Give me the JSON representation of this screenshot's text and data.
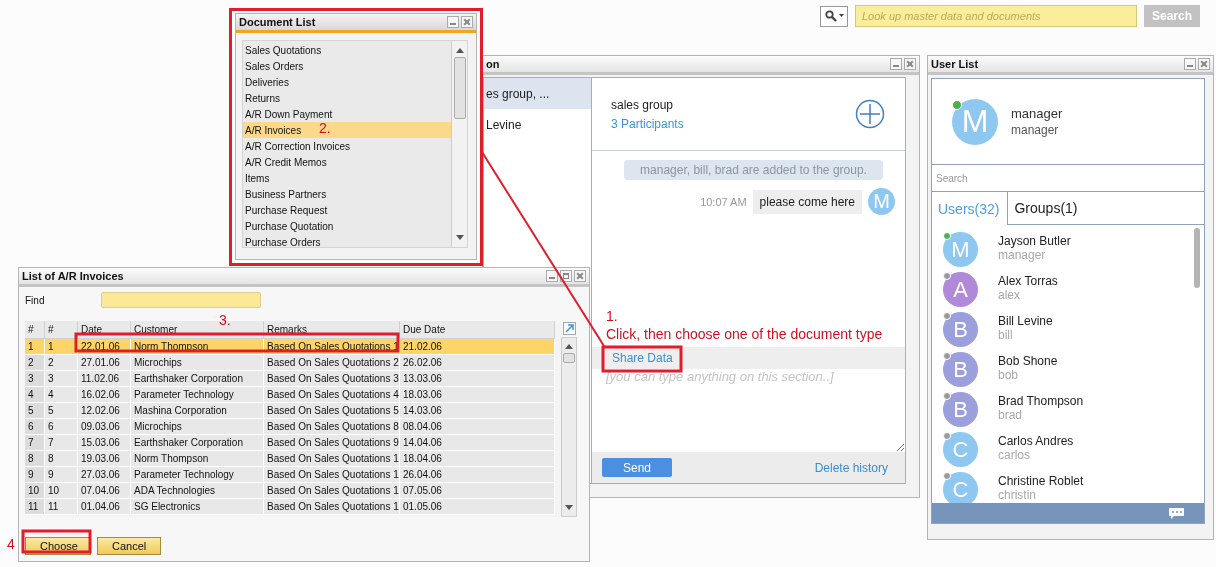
{
  "top_bar": {
    "search": {
      "placeholder": "Look up master data and documents"
    },
    "search_button": "Search"
  },
  "chat_window": {
    "title": "on",
    "active": false,
    "conversations": [
      {
        "label": "es group, ...",
        "selected": true
      },
      {
        "label": "Levine",
        "selected": false
      }
    ],
    "header": {
      "name": "sales group",
      "participants": "3 Participants"
    },
    "messages": [
      {
        "kind": "system",
        "text": "manager, bill, brad are added to the group."
      },
      {
        "kind": "outgoing",
        "time": "10:07 AM",
        "text": "please come here",
        "avatar": "M",
        "color": "#8ec8f0"
      }
    ],
    "share_link": "Share Data",
    "input": {
      "placeholder": "[you can type anything on this section..]"
    },
    "send_button": "Send",
    "delete_link": "Delete history"
  },
  "user_list": {
    "title": "User List",
    "active": false,
    "current_user": {
      "name": "manager",
      "username": "manager",
      "initial": "M",
      "color": "#8ec8f0",
      "online": true
    },
    "search": {
      "placeholder": "Search"
    },
    "tabs": [
      {
        "label": "Users(32)",
        "selected": true
      },
      {
        "label": "Groups(1)",
        "selected": false
      }
    ],
    "users": [
      {
        "name": "Jayson Butler",
        "username": "manager",
        "initial": "M",
        "color": "#8ec8f0",
        "online": true
      },
      {
        "name": "Alex Torras",
        "username": "alex",
        "initial": "A",
        "color": "#b08ad8",
        "online": false
      },
      {
        "name": "Bill Levine",
        "username": "bill",
        "initial": "B",
        "color": "#9b9fdc",
        "online": false
      },
      {
        "name": "Bob Shone",
        "username": "bob",
        "initial": "B",
        "color": "#9b9fdc",
        "online": false
      },
      {
        "name": "Brad Thompson",
        "username": "brad",
        "initial": "B",
        "color": "#9b9fdc",
        "online": false
      },
      {
        "name": "Carlos Andres",
        "username": "carlos",
        "initial": "C",
        "color": "#8ec8f0",
        "online": false
      },
      {
        "name": "Christine Roblet",
        "username": "christin",
        "initial": "C",
        "color": "#8ec8f0",
        "online": false
      }
    ]
  },
  "document_list": {
    "title": "Document List",
    "active": true,
    "items": [
      {
        "label": "Sales Quotations",
        "selected": false
      },
      {
        "label": "Sales Orders",
        "selected": false
      },
      {
        "label": "Deliveries",
        "selected": false
      },
      {
        "label": "Returns",
        "selected": false
      },
      {
        "label": "A/R Down Payment",
        "selected": false
      },
      {
        "label": "A/R Invoices",
        "selected": true
      },
      {
        "label": "A/R Correction Invoices",
        "selected": false
      },
      {
        "label": "A/R Credit Memos",
        "selected": false
      },
      {
        "label": "Items",
        "selected": false
      },
      {
        "label": "Business Partners",
        "selected": false
      },
      {
        "label": "Purchase Request",
        "selected": false
      },
      {
        "label": "Purchase Quotation",
        "selected": false
      },
      {
        "label": "Purchase Orders",
        "selected": false
      }
    ]
  },
  "invoice_list": {
    "title": "List of A/R Invoices",
    "active": false,
    "find_label": "Find",
    "columns": [
      "#",
      "#",
      "Date",
      "Customer",
      "Remarks",
      "Due Date"
    ],
    "rows": [
      {
        "cells": [
          "1",
          "1",
          "22.01.06",
          "Norm Thompson",
          "Based On Sales Quotations 1",
          "21.02.06"
        ],
        "selected": true
      },
      {
        "cells": [
          "2",
          "2",
          "27.01.06",
          "Microchips",
          "Based On Sales Quotations 2",
          "26.02.06"
        ],
        "selected": false
      },
      {
        "cells": [
          "3",
          "3",
          "11.02.06",
          "Earthshaker Corporation",
          "Based On Sales Quotations 3",
          "13.03.06"
        ],
        "selected": false
      },
      {
        "cells": [
          "4",
          "4",
          "16.02.06",
          "Parameter Technology",
          "Based On Sales Quotations 4",
          "18.03.06"
        ],
        "selected": false
      },
      {
        "cells": [
          "5",
          "5",
          "12.02.06",
          "Mashina Corporation",
          "Based On Sales Quotations 5",
          "14.03.06"
        ],
        "selected": false
      },
      {
        "cells": [
          "6",
          "6",
          "09.03.06",
          "Microchips",
          "Based On Sales Quotations 8",
          "08.04.06"
        ],
        "selected": false
      },
      {
        "cells": [
          "7",
          "7",
          "15.03.06",
          "Earthshaker Corporation",
          "Based On Sales Quotations 9",
          "14.04.06"
        ],
        "selected": false
      },
      {
        "cells": [
          "8",
          "8",
          "19.03.06",
          "Norm Thompson",
          "Based On Sales Quotations 1",
          "18.04.06"
        ],
        "selected": false
      },
      {
        "cells": [
          "9",
          "9",
          "27.03.06",
          "Parameter Technology",
          "Based On Sales Quotations 1",
          "26.04.06"
        ],
        "selected": false
      },
      {
        "cells": [
          "10",
          "10",
          "07.04.06",
          "ADA Technologies",
          "Based On Sales Quotations 1",
          "07.05.06"
        ],
        "selected": false
      },
      {
        "cells": [
          "11",
          "11",
          "01.04.06",
          "SG Electronics",
          "Based On Sales Quotations 1",
          "01.05.06"
        ],
        "selected": false
      }
    ],
    "buttons": [
      "Choose",
      "Cancel"
    ]
  },
  "annotations": {
    "step_1": {
      "number": "1.",
      "text": "Click, then choose one of the document type"
    },
    "step_2": "2.",
    "step_3": "3.",
    "step_4": "4"
  }
}
